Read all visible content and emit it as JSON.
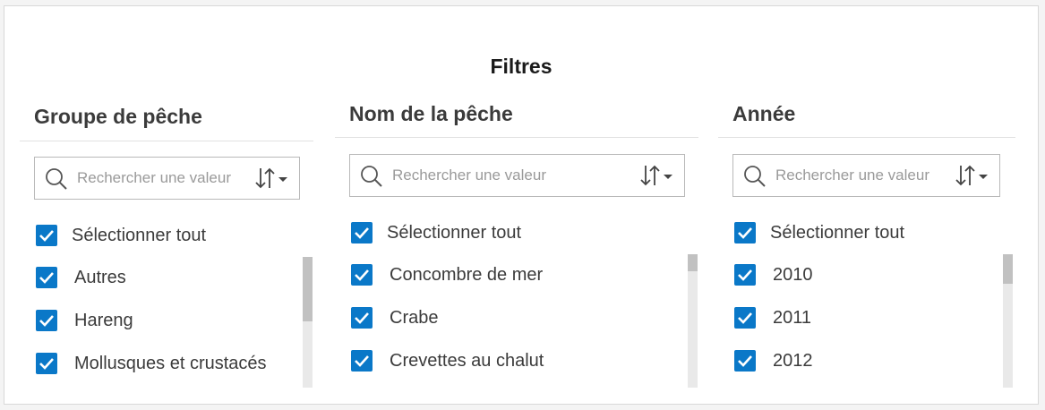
{
  "panel": {
    "title": "Filtres"
  },
  "columns": [
    {
      "header": "Groupe de pêche",
      "search_placeholder": "Rechercher une valeur",
      "select_all_label": "Sélectionner tout",
      "select_all_checked": true,
      "items": [
        {
          "label": "Autres",
          "checked": true
        },
        {
          "label": "Hareng",
          "checked": true
        },
        {
          "label": "Mollusques et crustacés",
          "checked": true
        }
      ]
    },
    {
      "header": "Nom de la pêche",
      "search_placeholder": "Rechercher une valeur",
      "select_all_label": "Sélectionner tout",
      "select_all_checked": true,
      "items": [
        {
          "label": "Concombre de mer",
          "checked": true
        },
        {
          "label": "Crabe",
          "checked": true
        },
        {
          "label": "Crevettes au chalut",
          "checked": true
        }
      ]
    },
    {
      "header": "Année",
      "search_placeholder": "Rechercher une valeur",
      "select_all_label": "Sélectionner tout",
      "select_all_checked": true,
      "items": [
        {
          "label": "2010",
          "checked": true
        },
        {
          "label": "2011",
          "checked": true
        },
        {
          "label": "2012",
          "checked": true
        }
      ]
    }
  ],
  "icons": {
    "search": "search-icon",
    "sort": "sort-icon",
    "check": "checkmark-icon"
  },
  "colors": {
    "checkbox": "#0a78c8",
    "text": "#3b3b3b",
    "placeholder": "#9a9a9a"
  }
}
